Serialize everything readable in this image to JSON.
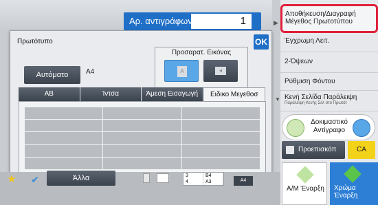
{
  "header": {
    "copies_label": "Αρ. αντιγράφων",
    "copies_value": "1"
  },
  "dialog": {
    "title": "Πρωτότυπο",
    "ok_label": "OK",
    "auto_label": "Αυτόματο",
    "paper_size": "A4",
    "adjust_title": "Προσαρατ. Εικόνας",
    "orient_a_icon": "A",
    "tabs": [
      "AB",
      "Ίντσα",
      "Άμεση Εισαγωγή",
      "Ειδικο Μεγεθοσ"
    ]
  },
  "sidebar": {
    "items": [
      {
        "label": "Αποθήκευση/Διαγραφή Μέγεθος Πρωτοτύπου",
        "sub": ""
      },
      {
        "label": "Έγχρωμη Λειτ.",
        "sub": ""
      },
      {
        "label": "2-Όψεων",
        "sub": ""
      },
      {
        "label": "Ρύθμιση Φόντου",
        "sub": ""
      },
      {
        "label": "Κενή Σελίδα Παράλειψη",
        "sub": "Παράλειψη Κενής Σελ στο Πρωτότ"
      }
    ],
    "proof_label": "Δοκιμαστικό Αντίγραφο",
    "preview_label": "Προεπισκόπ",
    "ca_label": "CA",
    "start_bw_label": "Α/Μ Έναρξη",
    "start_color_label": "Χρώμα Έναρξη"
  },
  "footer": {
    "star_icon": "★",
    "check_icon": "✔",
    "other_label": "Άλλα",
    "tray": [
      "3",
      "B4",
      "4",
      "A3"
    ],
    "paper_label": "A4"
  },
  "colors": {
    "accent": "#1f6fc7",
    "highlight": "#e0203a",
    "ca": "#f3d21a"
  }
}
